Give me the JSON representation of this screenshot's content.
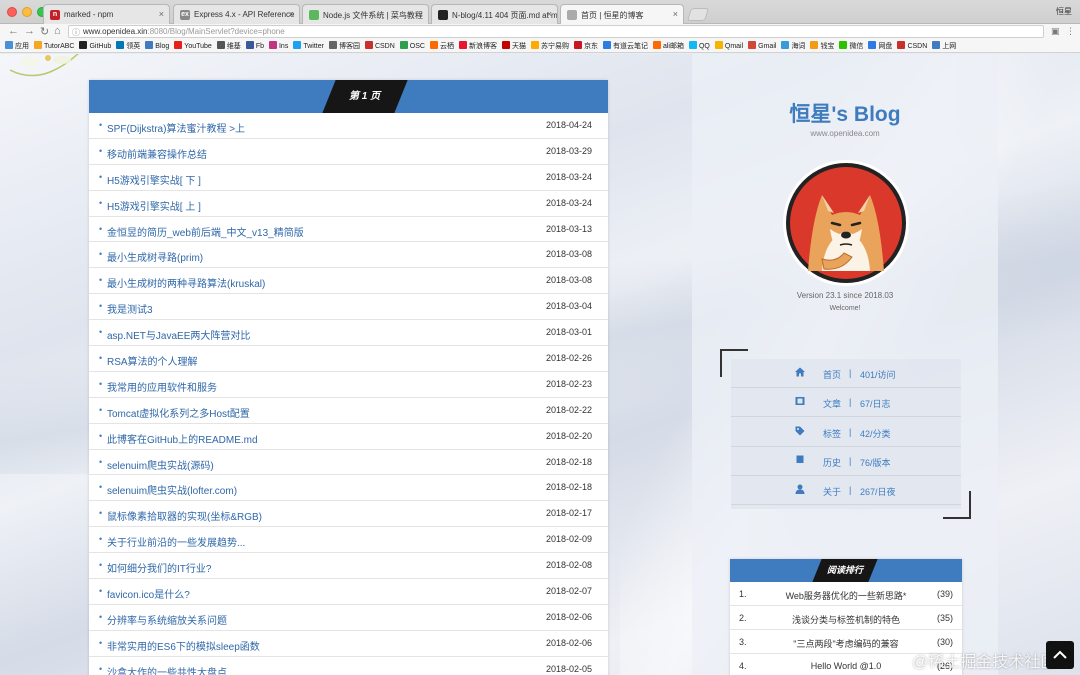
{
  "browser": {
    "tabs": [
      {
        "label": "marked - npm",
        "favicon_color": "#c12127",
        "glyph": "n"
      },
      {
        "label": "Express 4.x - API Reference",
        "favicon_color": "#888888",
        "glyph": "ex"
      },
      {
        "label": "Node.js 文件系统 | 菜鸟教程",
        "favicon_color": "#5cb85c",
        "glyph": ""
      },
      {
        "label": "N-blog/4.11 404 页面.md at m...",
        "favicon_color": "#222222",
        "glyph": ""
      },
      {
        "label": "首页 | 恒星的博客",
        "favicon_color": "#aaaaaa",
        "glyph": ""
      }
    ],
    "profile": "恒星",
    "url_host": "www.openidea.xin",
    "url_path": ":8080/Blog/MainServlet?device=phone",
    "bookmarks": [
      {
        "label": "应用",
        "color": "#4a90d9"
      },
      {
        "label": "TutorABC",
        "color": "#f5a623"
      },
      {
        "label": "GitHub",
        "color": "#222222"
      },
      {
        "label": "领英",
        "color": "#0077b5"
      },
      {
        "label": "Blog",
        "color": "#3e7cbf"
      },
      {
        "label": "YouTube",
        "color": "#e62117"
      },
      {
        "label": "维基",
        "color": "#555555"
      },
      {
        "label": "Fb",
        "color": "#3b5998"
      },
      {
        "label": "Ins",
        "color": "#c13584"
      },
      {
        "label": "Twitter",
        "color": "#1da1f2"
      },
      {
        "label": "博客园",
        "color": "#666666"
      },
      {
        "label": "CSDN",
        "color": "#c9302c"
      },
      {
        "label": "OSC",
        "color": "#2e9e4f"
      },
      {
        "label": "云栖",
        "color": "#ff6a00"
      },
      {
        "label": "新浪博客",
        "color": "#e6162d"
      },
      {
        "label": "天猫",
        "color": "#c40000"
      },
      {
        "label": "苏宁易购",
        "color": "#ffaa00"
      },
      {
        "label": "京东",
        "color": "#c91623"
      },
      {
        "label": "有道云笔记",
        "color": "#2a7de1"
      },
      {
        "label": "ali邮箱",
        "color": "#ff6a00"
      },
      {
        "label": "QQ",
        "color": "#12b7f5"
      },
      {
        "label": "Qmail",
        "color": "#f4b400"
      },
      {
        "label": "Gmail",
        "color": "#d44638"
      },
      {
        "label": "海词",
        "color": "#3a9ad9"
      },
      {
        "label": "钱宝",
        "color": "#f39c12"
      },
      {
        "label": "微信",
        "color": "#2dc100"
      },
      {
        "label": "网盘",
        "color": "#2e7be6"
      },
      {
        "label": "CSDN",
        "color": "#c9302c"
      },
      {
        "label": "上网",
        "color": "#3e7cbf"
      }
    ]
  },
  "posts_panel": {
    "title": "第 1 页",
    "posts": [
      {
        "title": "SPF(Dijkstra)算法蜜汁教程 >上",
        "date": "2018-04-24"
      },
      {
        "title": "移动前端兼容操作总结",
        "date": "2018-03-29"
      },
      {
        "title": "H5游戏引擎实战[ 下 ]",
        "date": "2018-03-24"
      },
      {
        "title": "H5游戏引擎实战[ 上 ]",
        "date": "2018-03-24"
      },
      {
        "title": "金恒昱的简历_web前后端_中文_v13_精简版",
        "date": "2018-03-13"
      },
      {
        "title": "最小生成树寻路(prim)",
        "date": "2018-03-08"
      },
      {
        "title": "最小生成树的两种寻路算法(kruskal)",
        "date": "2018-03-08"
      },
      {
        "title": "我是测试3",
        "date": "2018-03-04"
      },
      {
        "title": "asp.NET与JavaEE两大阵营对比",
        "date": "2018-03-01"
      },
      {
        "title": "RSA算法的个人理解",
        "date": "2018-02-26"
      },
      {
        "title": "我常用的应用软件和服务",
        "date": "2018-02-23"
      },
      {
        "title": "Tomcat虚拟化系列之多Host配置",
        "date": "2018-02-22"
      },
      {
        "title": "此博客在GitHub上的README.md",
        "date": "2018-02-20"
      },
      {
        "title": "selenuim爬虫实战(源码)",
        "date": "2018-02-18"
      },
      {
        "title": "selenuim爬虫实战(lofter.com)",
        "date": "2018-02-18"
      },
      {
        "title": "鼠标像素拾取器的实现(坐标&RGB)",
        "date": "2018-02-17"
      },
      {
        "title": "关于行业前沿的一些发展趋势...",
        "date": "2018-02-09"
      },
      {
        "title": "如何细分我们的IT行业?",
        "date": "2018-02-08"
      },
      {
        "title": "favicon.ico是什么?",
        "date": "2018-02-07"
      },
      {
        "title": "分辨率与系统缩放关系问题",
        "date": "2018-02-06"
      },
      {
        "title": "非常实用的ES6下的模拟sleep函数",
        "date": "2018-02-06"
      },
      {
        "title": "沙盒大作的一些共性大盘点",
        "date": "2018-02-05"
      }
    ]
  },
  "sidebar": {
    "blog_name": "恒星's Blog",
    "blog_url": "www.openidea.com",
    "version": "Version 23.1 since 2018.03",
    "welcome": "Welcome!",
    "stats": [
      {
        "icon": "home-icon",
        "label": "首页",
        "value": "401/访问"
      },
      {
        "icon": "film-icon",
        "label": "文章",
        "value": "67/日志"
      },
      {
        "icon": "tags-icon",
        "label": "标签",
        "value": "42/分类"
      },
      {
        "icon": "book-icon",
        "label": "历史",
        "value": "76/版本"
      },
      {
        "icon": "user-icon",
        "label": "关于",
        "value": "267/日夜"
      }
    ],
    "ranking": {
      "title": "阅读排行",
      "items": [
        {
          "num": "1.",
          "title": "Web服务器优化的一些新思路*",
          "count": "(39)"
        },
        {
          "num": "2.",
          "title": "浅谈分类与标签机制的特色",
          "count": "(35)"
        },
        {
          "num": "3.",
          "title": "\"三点两段\"考虑编码的兼容",
          "count": "(30)"
        },
        {
          "num": "4.",
          "title": "Hello World @1.0",
          "count": "(26)"
        }
      ]
    }
  },
  "watermark": "@稀土掘金技术社区",
  "colors": {
    "accent": "#3e7cbf",
    "title_bg": "#161616"
  }
}
